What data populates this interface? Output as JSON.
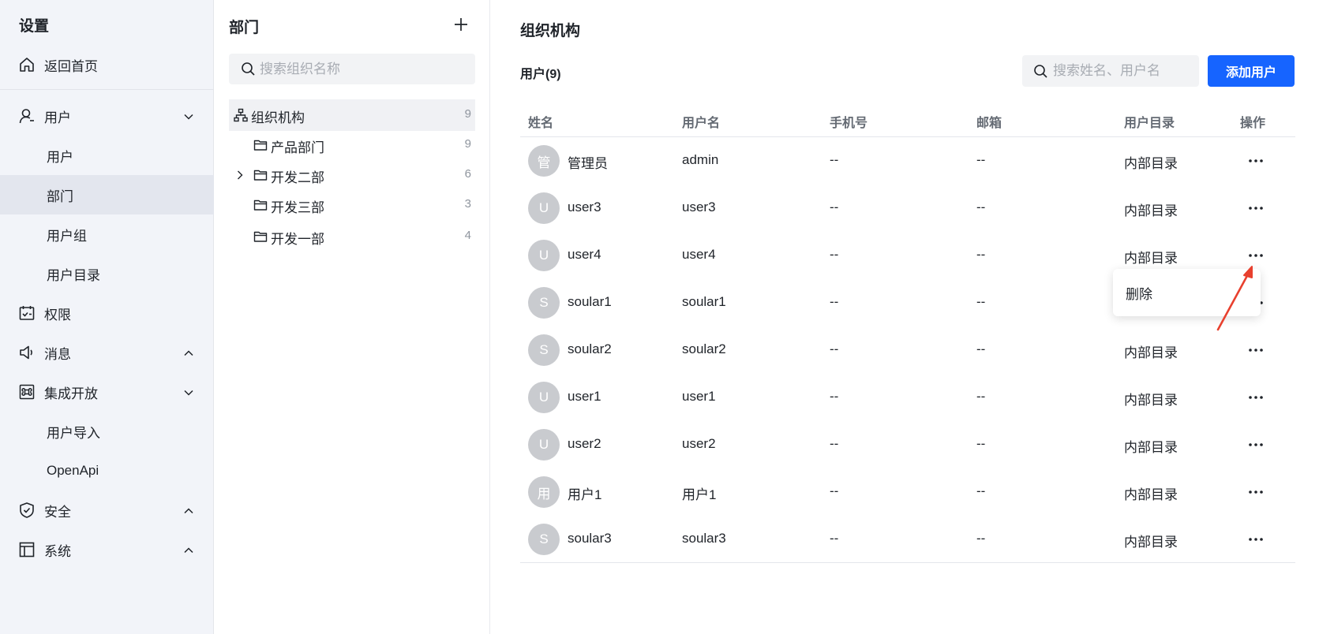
{
  "sidebar": {
    "title": "设置",
    "home": "返回首页",
    "sections": {
      "users": "用户",
      "users_children": [
        "用户",
        "部门",
        "用户组",
        "用户目录"
      ],
      "permissions": "权限",
      "messages": "消息",
      "integration": "集成开放",
      "integration_children": [
        "用户导入",
        "OpenApi"
      ],
      "security": "安全",
      "system": "系统"
    },
    "active_item": "部门"
  },
  "dept": {
    "title": "部门",
    "search_placeholder": "搜索组织名称",
    "tree": [
      {
        "label": "组织机构",
        "count": "9"
      },
      {
        "label": "产品部门",
        "count": "9"
      },
      {
        "label": "开发二部",
        "count": "6"
      },
      {
        "label": "开发三部",
        "count": "3"
      },
      {
        "label": "开发一部",
        "count": "4"
      }
    ]
  },
  "main": {
    "title": "组织机构",
    "users_count": "用户(9)",
    "search_placeholder": "搜索姓名、用户名",
    "add_button": "添加用户",
    "columns": [
      "姓名",
      "用户名",
      "手机号",
      "邮箱",
      "用户目录",
      "操作"
    ],
    "rows": [
      {
        "avatar": "管",
        "name": "管理员",
        "username": "admin",
        "phone": "--",
        "email": "--",
        "directory": "内部目录"
      },
      {
        "avatar": "U",
        "name": "user3",
        "username": "user3",
        "phone": "--",
        "email": "--",
        "directory": "内部目录"
      },
      {
        "avatar": "U",
        "name": "user4",
        "username": "user4",
        "phone": "--",
        "email": "--",
        "directory": "内部目录"
      },
      {
        "avatar": "S",
        "name": "soular1",
        "username": "soular1",
        "phone": "--",
        "email": "--",
        "directory": ""
      },
      {
        "avatar": "S",
        "name": "soular2",
        "username": "soular2",
        "phone": "--",
        "email": "--",
        "directory": "内部目录"
      },
      {
        "avatar": "U",
        "name": "user1",
        "username": "user1",
        "phone": "--",
        "email": "--",
        "directory": "内部目录"
      },
      {
        "avatar": "U",
        "name": "user2",
        "username": "user2",
        "phone": "--",
        "email": "--",
        "directory": "内部目录"
      },
      {
        "avatar": "用",
        "name": "用户1",
        "username": "用户1",
        "phone": "--",
        "email": "--",
        "directory": "内部目录"
      },
      {
        "avatar": "S",
        "name": "soular3",
        "username": "soular3",
        "phone": "--",
        "email": "--",
        "directory": "内部目录"
      }
    ],
    "dropdown": {
      "item": "删除"
    }
  },
  "colors": {
    "primary": "#1664ff",
    "sidebar_bg": "#f2f4f9",
    "active_bg": "#e3e6ee",
    "annotation_arrow": "#e8402e"
  },
  "icons": {
    "home": "home-icon",
    "users": "user-icon",
    "permissions": "calendar-check-icon",
    "messages": "megaphone-icon",
    "integration": "command-icon",
    "security": "shield-check-icon",
    "system": "layout-icon",
    "org": "org-tree-icon",
    "folder": "folder-icon",
    "search": "search-icon",
    "more": "more-horizontal-icon"
  }
}
